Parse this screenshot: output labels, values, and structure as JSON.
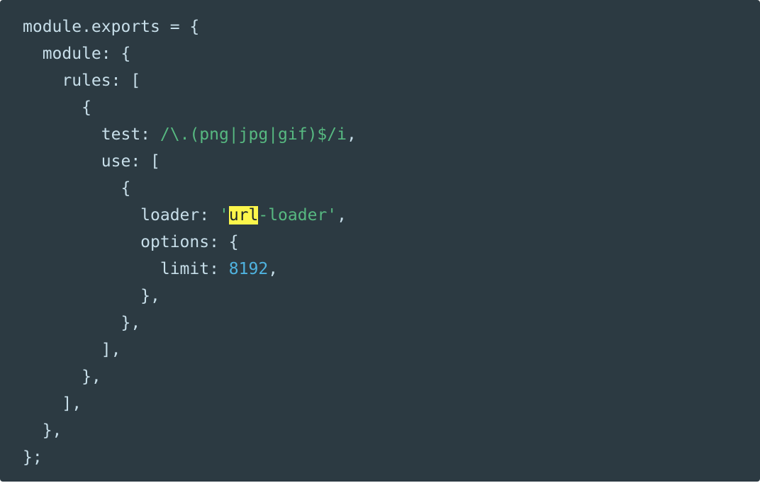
{
  "colors": {
    "background": "#2c3a42",
    "text": "#c7dee9",
    "string": "#57b981",
    "number": "#4fb3e0",
    "highlight": "#fdf64b"
  },
  "code": {
    "line1": "module.exports = {",
    "line2": "  module: {",
    "line3": "    rules: [",
    "line4": "      {",
    "line5_key": "        test: ",
    "line5_regex": "/\\.(png|jpg|gif)$/i",
    "line5_end": ",",
    "line6": "        use: [",
    "line7": "          {",
    "line8_key": "            loader: ",
    "line8_quote_open": "'",
    "line8_highlight": "url",
    "line8_rest": "-loader'",
    "line8_end": ",",
    "line9": "            options: {",
    "line10_key": "              limit: ",
    "line10_number": "8192",
    "line10_end": ",",
    "line11": "            },",
    "line12": "          },",
    "line13": "        ],",
    "line14": "      },",
    "line15": "    ],",
    "line16": "  },",
    "line17": "};"
  }
}
